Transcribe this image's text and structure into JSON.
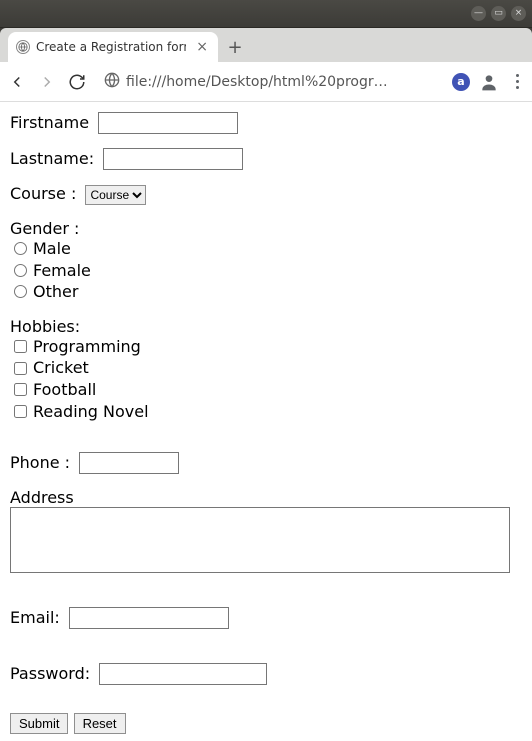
{
  "window": {
    "title_btns": {
      "minimize": "—",
      "maximize": "▭",
      "close": "×"
    }
  },
  "browser": {
    "tab_title": "Create a Registration form",
    "url_display": "file:///home/Desktop/html%20progr…",
    "extension_letter": "a"
  },
  "form": {
    "firstname_label": "Firstname",
    "firstname_value": "",
    "lastname_label": "Lastname:",
    "lastname_value": "",
    "course_label": "Course :",
    "course_selected": "Course",
    "gender_label": "Gender :",
    "gender_options": [
      "Male",
      "Female",
      "Other"
    ],
    "hobbies_label": "Hobbies:",
    "hobbies_options": [
      "Programming",
      "Cricket",
      "Football",
      "Reading Novel"
    ],
    "phone_label": "Phone :",
    "phone_value": "",
    "address_label": "Address",
    "address_value": "",
    "email_label": "Email:",
    "email_value": "",
    "password_label": "Password:",
    "password_value": "",
    "submit_label": "Submit",
    "reset_label": "Reset"
  }
}
